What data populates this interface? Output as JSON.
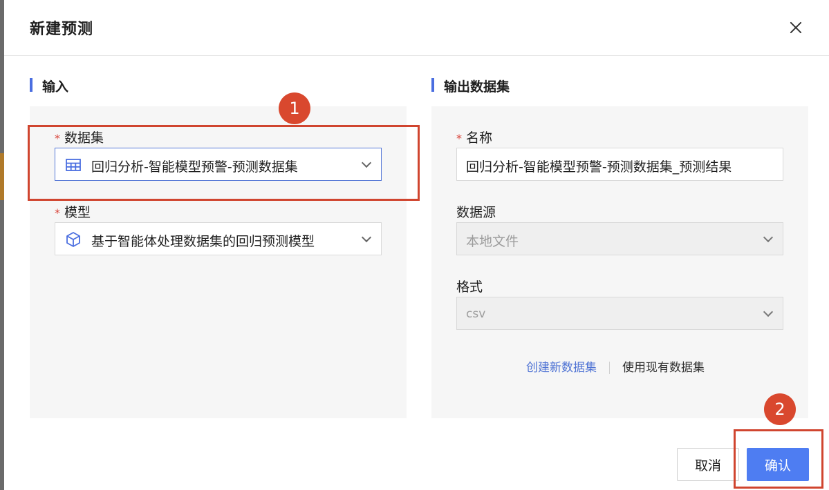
{
  "dialog": {
    "title": "新建预测"
  },
  "input_section": {
    "title": "输入",
    "dataset": {
      "required_mark": "*",
      "label": "数据集",
      "value": "回归分析-智能模型预警-预测数据集",
      "icon": "table-icon"
    },
    "model": {
      "required_mark": "*",
      "label": "模型",
      "value": "基于智能体处理数据集的回归预测模型",
      "icon": "cube-icon"
    }
  },
  "output_section": {
    "title": "输出数据集",
    "name": {
      "required_mark": "*",
      "label": "名称",
      "value": "回归分析-智能模型预警-预测数据集_预测结果"
    },
    "source": {
      "label": "数据源",
      "value": "本地文件"
    },
    "format": {
      "label": "格式",
      "value": "csv"
    },
    "links": {
      "create_new": "创建新数据集",
      "use_existing": "使用现有数据集"
    }
  },
  "footer": {
    "cancel_label": "取消",
    "confirm_label": "确认"
  },
  "annotations": {
    "step1": "1",
    "step2": "2"
  },
  "colors": {
    "accent": "#4e7df2",
    "link": "#4f73d4",
    "annotation": "#d0452f"
  }
}
